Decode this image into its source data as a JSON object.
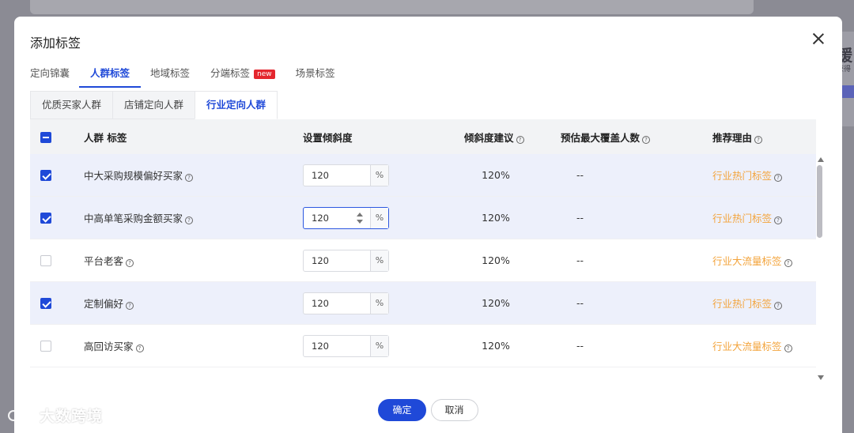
{
  "background": {
    "right_glyph": "缓",
    "right_sub": "获得"
  },
  "modal": {
    "title": "添加标签",
    "tabs": [
      {
        "label": "定向锦囊",
        "active": false
      },
      {
        "label": "人群标签",
        "active": true
      },
      {
        "label": "地域标签",
        "active": false
      },
      {
        "label": "分端标签",
        "active": false,
        "badge": "new"
      },
      {
        "label": "场景标签",
        "active": false
      }
    ],
    "subtabs": [
      {
        "label": "优质买家人群",
        "active": false
      },
      {
        "label": "店铺定向人群",
        "active": false
      },
      {
        "label": "行业定向人群",
        "active": true
      }
    ],
    "table": {
      "headers": {
        "name": "人群 标签",
        "slope": "设置倾斜度",
        "suggestion": "倾斜度建议",
        "coverage": "预估最大覆盖人数",
        "reason": "推荐理由"
      },
      "header_checkbox": "indeterminate",
      "rows": [
        {
          "checked": true,
          "name": "中大采购规模偏好买家",
          "value": "120",
          "unit": "%",
          "suggestion": "120%",
          "coverage": "--",
          "reason": "行业热门标签"
        },
        {
          "checked": true,
          "name": "中高单笔采购金额买家",
          "value": "120",
          "unit": "%",
          "suggestion": "120%",
          "coverage": "--",
          "reason": "行业热门标签",
          "focused": true
        },
        {
          "checked": false,
          "name": "平台老客",
          "value": "120",
          "unit": "%",
          "suggestion": "120%",
          "coverage": "--",
          "reason": "行业大流量标签"
        },
        {
          "checked": true,
          "name": "定制偏好",
          "value": "120",
          "unit": "%",
          "suggestion": "120%",
          "coverage": "--",
          "reason": "行业热门标签"
        },
        {
          "checked": false,
          "name": "高回访买家",
          "value": "120",
          "unit": "%",
          "suggestion": "120%",
          "coverage": "--",
          "reason": "行业大流量标签"
        }
      ]
    },
    "footer": {
      "confirm": "确定",
      "cancel": "取消"
    }
  },
  "watermark": {
    "text": "大数跨境"
  },
  "colors": {
    "primary": "#1f49d8",
    "reason": "#f3a43c",
    "badge": "#e4262e",
    "selected_row": "#edf0fb"
  }
}
